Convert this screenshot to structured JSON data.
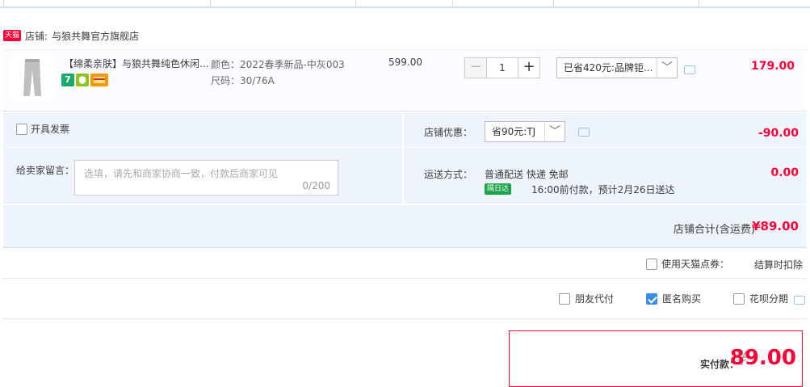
{
  "store": {
    "badge": "天猫",
    "prefix": "店铺:",
    "name": "与狼共舞官方旗舰店"
  },
  "item": {
    "title": "【绵柔亲肤】与狼共舞纯色休闲...",
    "icon_badge": "7",
    "color": "颜色：2022春季新品-中灰003",
    "size": "尺码：30/76A",
    "price": "599.00",
    "quantity": "1",
    "minus": "−",
    "plus": "+",
    "promo": "已省420元:品牌钜...",
    "arrow": "﹀",
    "subtotal": "179.00"
  },
  "invoice": {
    "label": "开具发票"
  },
  "message": {
    "label": "给卖家留言：",
    "placeholder": "选填，请先和商家协商一致，付款后商家可见",
    "counter": "0/200"
  },
  "shop_discount": {
    "label": "店铺优惠：",
    "value": "省90元:TJ",
    "amount": "-90.00"
  },
  "shipping": {
    "label": "运送方式：",
    "method": "普通配送 快递 免邮",
    "badge": "隔日达",
    "time": "16:00前付款，预计2月26日送达",
    "fee": "0.00"
  },
  "store_total": {
    "label": "店铺合计(含运费)",
    "amount": "¥89.00"
  },
  "points": {
    "label": "使用天猫点券：",
    "note": "结算时扣除"
  },
  "options": {
    "friend_pay": "朋友代付",
    "anonymous": "匿名购买",
    "huabei": "花呗分期"
  },
  "payment": {
    "label": "实付款：",
    "currency": "¥",
    "amount": "89.00"
  },
  "colors": {
    "accent": "#ff0036",
    "panel": "#eef4fc",
    "checkbox": "#3b8ee6"
  }
}
